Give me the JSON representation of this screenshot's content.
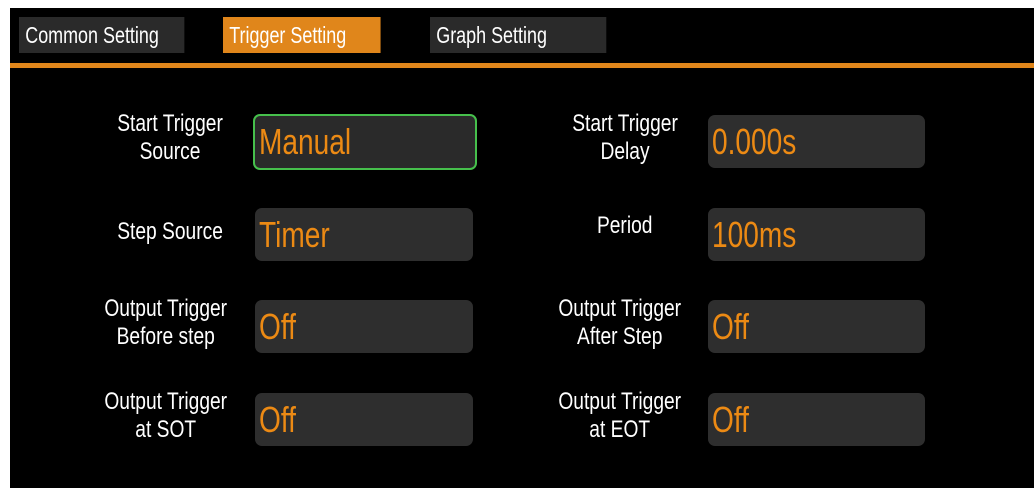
{
  "tabs": {
    "common": "Common Setting",
    "trigger": "Trigger Setting",
    "graph": "Graph Setting",
    "active_color": "#e0861b"
  },
  "fields": {
    "start_trigger_source": {
      "label_line1": "Start Trigger",
      "label_line2": "Source",
      "value": "Manual"
    },
    "start_trigger_delay": {
      "label_line1": "Start Trigger",
      "label_line2": "Delay",
      "value": "0.000s"
    },
    "step_source": {
      "label_line1": "Step Source",
      "value": "Timer"
    },
    "period": {
      "label_line1": "Period",
      "value": "100ms"
    },
    "output_trigger_before_step": {
      "label_line1": "Output Trigger",
      "label_line2": "Before step",
      "value": "Off"
    },
    "output_trigger_after_step": {
      "label_line1": "Output Trigger",
      "label_line2": "After Step",
      "value": "Off"
    },
    "output_trigger_at_sot": {
      "label_line1": "Output Trigger",
      "label_line2": "at SOT",
      "value": "Off"
    },
    "output_trigger_at_eot": {
      "label_line1": "Output Trigger",
      "label_line2": "at EOT",
      "value": "Off"
    }
  },
  "colors": {
    "value_text": "#ec8a14",
    "focus_border": "#46c04c",
    "field_bg": "#2e2e2e"
  }
}
